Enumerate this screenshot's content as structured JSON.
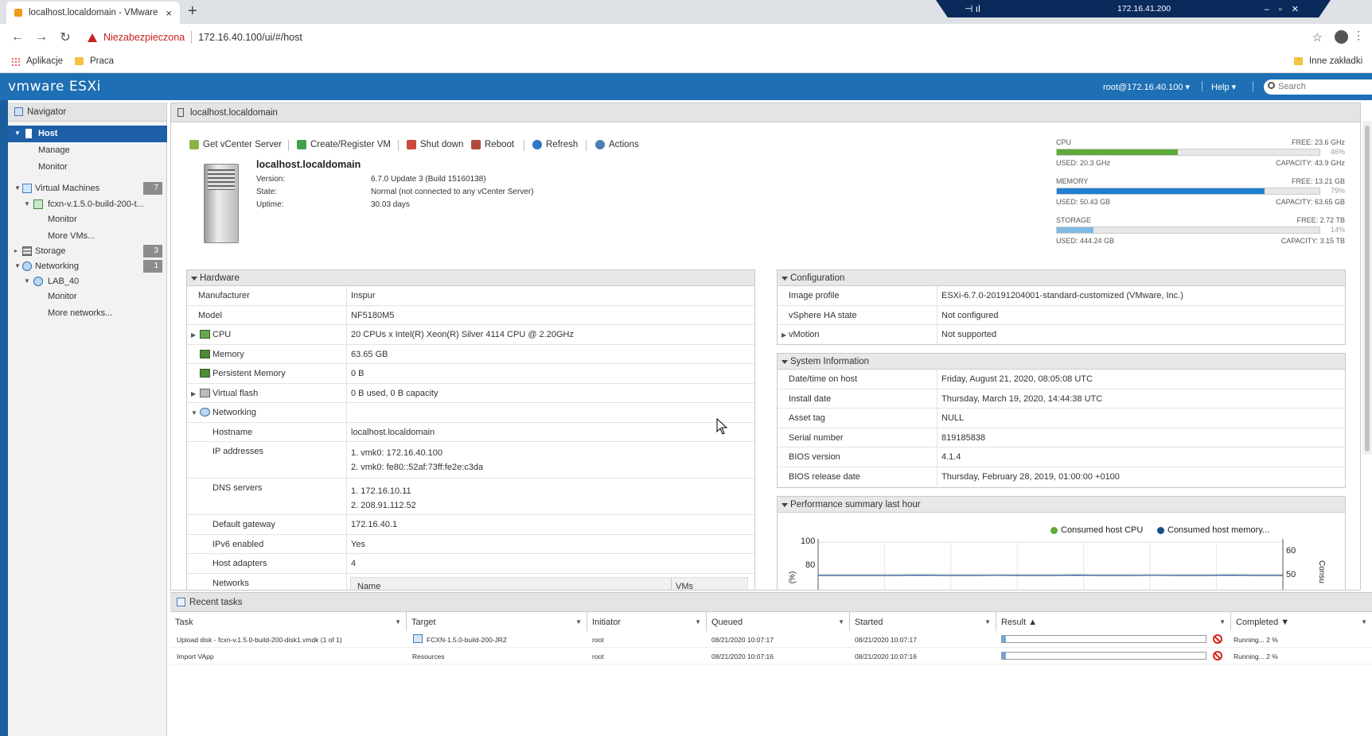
{
  "browser": {
    "tab_title": "localhost.localdomain - VMware",
    "tab_close": "×",
    "new_tab": "+",
    "security_warning": "Niezabezpieczona",
    "url": "172.16.40.100/ui/#/host",
    "bookmarks": [
      "Aplikacje",
      "Praca"
    ],
    "other_bookmarks": "Inne zakładki",
    "remote_session_ip": "172.16.41.200"
  },
  "header": {
    "logo": "vmware ESXi",
    "user": "root@172.16.40.100 ▾",
    "help": "Help ▾",
    "search_placeholder": "Search"
  },
  "navigator": {
    "title": "Navigator",
    "items": {
      "host": "Host",
      "manage": "Manage",
      "monitor": "Monitor",
      "virtual_machines": "Virtual Machines",
      "vm_count": "7",
      "vm_name": "fcxn-v.1.5.0-build-200-t...",
      "vm_monitor": "Monitor",
      "more_vms": "More VMs...",
      "storage": "Storage",
      "storage_count": "3",
      "networking": "Networking",
      "networking_count": "1",
      "network_name": "LAB_40",
      "net_monitor": "Monitor",
      "more_networks": "More networks..."
    }
  },
  "content": {
    "title": "localhost.localdomain",
    "toolbar": {
      "get_vcenter": "Get vCenter Server",
      "create_vm": "Create/Register VM",
      "shutdown": "Shut down",
      "reboot": "Reboot",
      "refresh": "Refresh",
      "actions": "Actions"
    },
    "summary": {
      "hostname": "localhost.localdomain",
      "version_label": "Version:",
      "version": "6.7.0 Update 3 (Build 15160138)",
      "state_label": "State:",
      "state": "Normal (not connected to any vCenter Server)",
      "uptime_label": "Uptime:",
      "uptime": "30.03 days"
    },
    "meters": {
      "cpu": {
        "label": "CPU",
        "free": "FREE: 23.6 GHz",
        "pct": "46%",
        "used": "USED: 20.3 GHz",
        "capacity": "CAPACITY: 43.9 GHz",
        "fill": 0.46,
        "color": "#5fa83a"
      },
      "memory": {
        "label": "MEMORY",
        "free": "FREE: 13.21 GB",
        "pct": "79%",
        "used": "USED: 50.43 GB",
        "capacity": "CAPACITY: 63.65 GB",
        "fill": 0.79,
        "color": "#1f7fd1"
      },
      "storage": {
        "label": "STORAGE",
        "free": "FREE: 2.72 TB",
        "pct": "14%",
        "used": "USED: 444.24 GB",
        "capacity": "CAPACITY: 3.15 TB",
        "fill": 0.14,
        "color": "#7fb9e3"
      }
    },
    "hardware": {
      "title": "Hardware",
      "manufacturer_k": "Manufacturer",
      "manufacturer_v": "Inspur",
      "model_k": "Model",
      "model_v": "NF5180M5",
      "cpu_k": "CPU",
      "cpu_v": "20 CPUs x Intel(R) Xeon(R) Silver 4114 CPU @ 2.20GHz",
      "memory_k": "Memory",
      "memory_v": "63.65 GB",
      "pmem_k": "Persistent Memory",
      "pmem_v": "0 B",
      "vflash_k": "Virtual flash",
      "vflash_v": "0 B used, 0 B capacity",
      "networking_k": "Networking",
      "hostname_k": "Hostname",
      "hostname_v": "localhost.localdomain",
      "ip_k": "IP addresses",
      "ip_v1": "1. vmk0: 172.16.40.100",
      "ip_v2": "2. vmk0: fe80::52af:73ff:fe2e:c3da",
      "dns_k": "DNS servers",
      "dns_v1": "1. 172.16.10.11",
      "dns_v2": "2. 208.91.112.52",
      "gw_k": "Default gateway",
      "gw_v": "172.16.40.1",
      "ipv6_k": "IPv6 enabled",
      "ipv6_v": "Yes",
      "adapters_k": "Host adapters",
      "adapters_v": "4",
      "networks_k": "Networks",
      "networks_col_name": "Name",
      "networks_col_vms": "VMs"
    },
    "configuration": {
      "title": "Configuration",
      "image_k": "Image profile",
      "image_v": "ESXi-6.7.0-20191204001-standard-customized (VMware, Inc.)",
      "ha_k": "vSphere HA state",
      "ha_v": "Not configured",
      "vmotion_k": "vMotion",
      "vmotion_v": "Not supported"
    },
    "sysinfo": {
      "title": "System Information",
      "date_k": "Date/time on host",
      "date_v": "Friday, August 21, 2020, 08:05:08 UTC",
      "install_k": "Install date",
      "install_v": "Thursday, March 19, 2020, 14:44:38 UTC",
      "asset_k": "Asset tag",
      "asset_v": "NULL",
      "serial_k": "Serial number",
      "serial_v": "819185838",
      "bios_k": "BIOS version",
      "bios_v": "4.1.4",
      "biosdate_k": "BIOS release date",
      "biosdate_v": "Thursday, February 28, 2019, 01:00:00 +0100"
    },
    "performance": {
      "title": "Performance summary last hour",
      "legend_cpu": "Consumed host CPU",
      "legend_mem": "Consumed host memory...",
      "y_left_ticks": [
        "100",
        "80"
      ],
      "y_left_unit": "(%)",
      "y_right_ticks": [
        "60",
        "50"
      ],
      "y_right_label": "Consu"
    }
  },
  "tasks": {
    "title": "Recent tasks",
    "columns": [
      "Task",
      "Target",
      "Initiator",
      "Queued",
      "Started",
      "Result ▲",
      "Completed ▼"
    ],
    "rows": [
      {
        "task": "Upload disk - fcxn-v.1.5.0-build-200-disk1.vmdk (1 of 1)",
        "target": "FCXN-1.5.0-build-200-JRZ",
        "initiator": "root",
        "queued": "08/21/2020 10:07:17",
        "started": "08/21/2020 10:07:17",
        "progress": 0.02,
        "completed": "Running... 2 %"
      },
      {
        "task": "Import VApp",
        "target": "Resources",
        "initiator": "root",
        "queued": "08/21/2020 10:07:16",
        "started": "08/21/2020 10:07:16",
        "progress": 0.02,
        "completed": "Running... 2 %"
      }
    ]
  },
  "chart_data": {
    "type": "line",
    "title": "Performance summary last hour",
    "series": [
      {
        "name": "Consumed host CPU",
        "color": "#5fa83a",
        "values": []
      },
      {
        "name": "Consumed host memory...",
        "color": "#1a4f8a",
        "values": [
          79,
          79,
          79,
          79,
          79.2,
          79,
          79,
          79.1,
          79,
          79,
          79.2,
          79,
          79,
          79.1,
          79,
          79,
          79.2,
          79,
          79
        ]
      }
    ],
    "ylim": [
      70,
      100
    ],
    "y_ticks": [
      "100",
      "80"
    ],
    "y2_ticks": [
      "60",
      "50"
    ]
  }
}
